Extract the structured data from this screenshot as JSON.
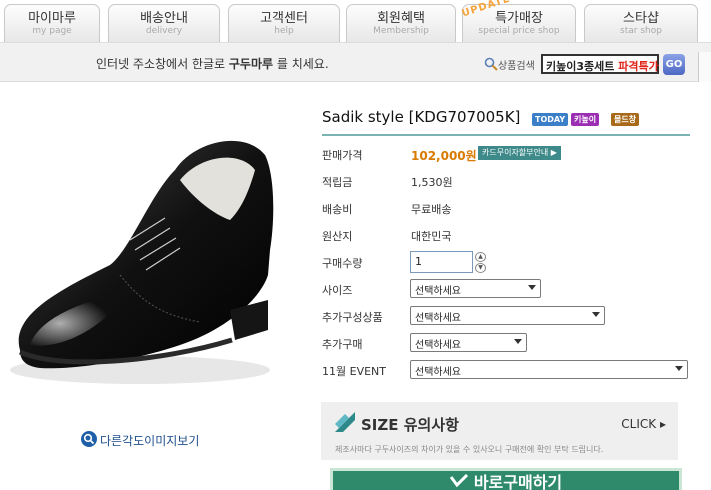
{
  "tabs": [
    {
      "label": "마이마루",
      "sub": "my page"
    },
    {
      "label": "배송안내",
      "sub": "delivery"
    },
    {
      "label": "고객센터",
      "sub": "help"
    },
    {
      "label": "회원혜택",
      "sub": "Membership"
    },
    {
      "label": "특가매장",
      "sub": "special price shop",
      "badge": "UPDATE"
    },
    {
      "label": "스타샵",
      "sub": "star shop"
    }
  ],
  "searchbar": {
    "hint_pre": "인터넷 주소창에서 한글로 ",
    "hint_brand": "구두마루",
    "hint_post": " 를 치세요.",
    "product_search_label": "상품검색",
    "keyword_main": "키높이3종세트 ",
    "keyword_hot": "파격특가",
    "go_label": "GO"
  },
  "product": {
    "title": "Sadik style [KDG707005K]",
    "badges": [
      {
        "text": "TODAY",
        "color": "#3a7fc8"
      },
      {
        "text": "키높이",
        "color": "#9b2fb3"
      },
      {
        "text": "몰드창",
        "color": "#a86a1a"
      }
    ],
    "price_label": "판매가격",
    "price": "102,000원",
    "card_button": "카드무이자할부안내 ▶",
    "points_label": "적립금",
    "points": "1,530원",
    "shipping_label": "배송비",
    "shipping": "무료배송",
    "origin_label": "원산지",
    "origin": "대한민국",
    "qty_label": "구매수량",
    "qty_value": "1",
    "size_label": "사이즈",
    "size_select": "선택하세요",
    "addon_label": "추가구성상품",
    "addon_select": "선택하세요",
    "extra_label": "추가구매",
    "extra_select": "선택하세요",
    "event_label": "11월 EVENT",
    "event_select": "선택하세요"
  },
  "other_angle_label": "다른각도이미지보기",
  "size_notice": {
    "title": "SIZE 유의사항",
    "click": "CLICK ▸",
    "desc": "제조사마다 구두사이즈의 차이가 있을 수 있사오니 구매전에 확인 부탁 드립니다."
  },
  "buy_label": "바로구매하기",
  "colors": {
    "accent": "#3e8a8a",
    "price": "#d87b00",
    "hot": "#e0251b"
  }
}
